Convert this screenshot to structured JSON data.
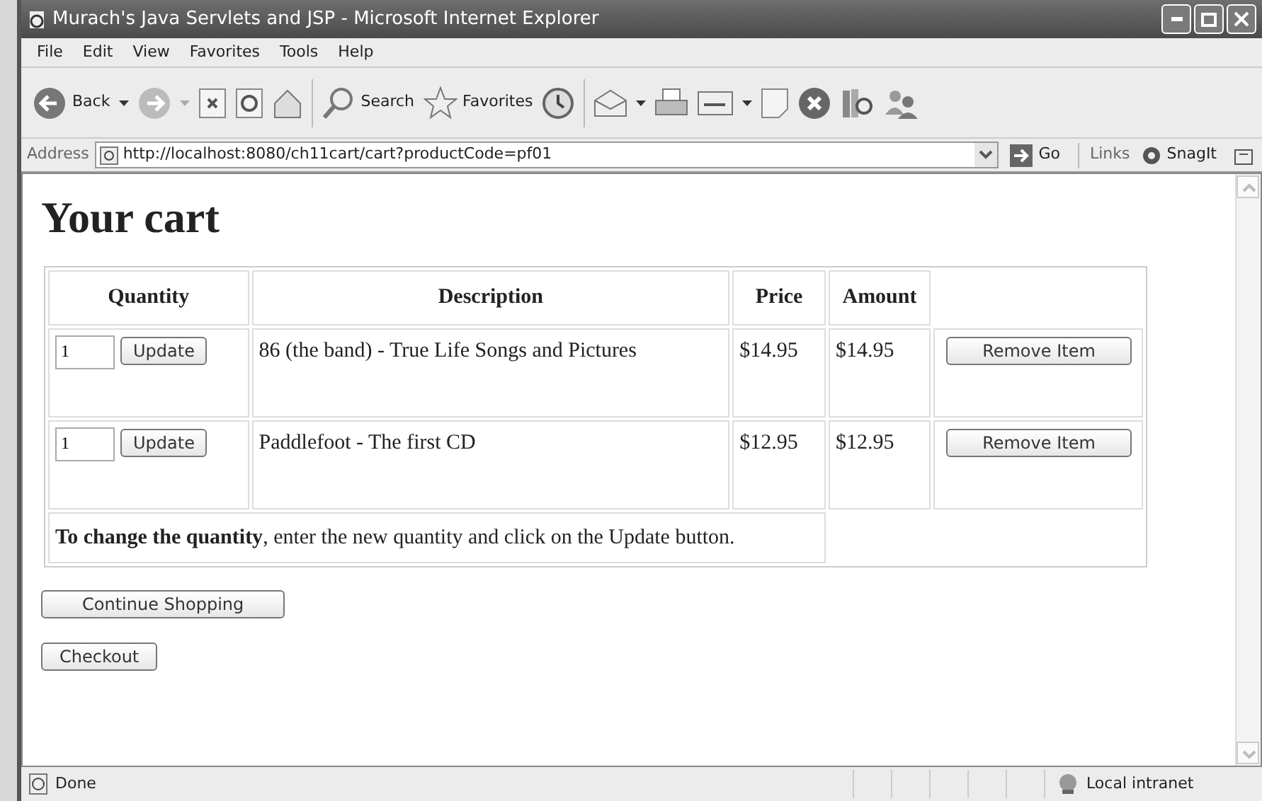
{
  "window": {
    "title": "Murach's Java Servlets and JSP - Microsoft Internet Explorer"
  },
  "menu": [
    "File",
    "Edit",
    "View",
    "Favorites",
    "Tools",
    "Help"
  ],
  "toolbar": {
    "back": "Back",
    "search": "Search",
    "favorites": "Favorites"
  },
  "address_bar": {
    "label": "Address",
    "url": "http://localhost:8080/ch11cart/cart?productCode=pf01",
    "go": "Go",
    "links": "Links",
    "snagit": "SnagIt"
  },
  "page": {
    "heading": "Your cart",
    "columns": [
      "Quantity",
      "Description",
      "Price",
      "Amount"
    ],
    "rows": [
      {
        "quantity": "1",
        "update": "Update",
        "description": "86 (the band) - True Life Songs and Pictures",
        "price": "$14.95",
        "amount": "$14.95",
        "remove": "Remove Item"
      },
      {
        "quantity": "1",
        "update": "Update",
        "description": "Paddlefoot - The first CD",
        "price": "$12.95",
        "amount": "$12.95",
        "remove": "Remove Item"
      }
    ],
    "note": "**To change the quantity**, enter the new quantity and click on the Update button.",
    "buttons": [
      "Continue Shopping",
      "Checkout"
    ]
  },
  "status_bar": {
    "text": "Done",
    "zone": "Local intranet"
  }
}
